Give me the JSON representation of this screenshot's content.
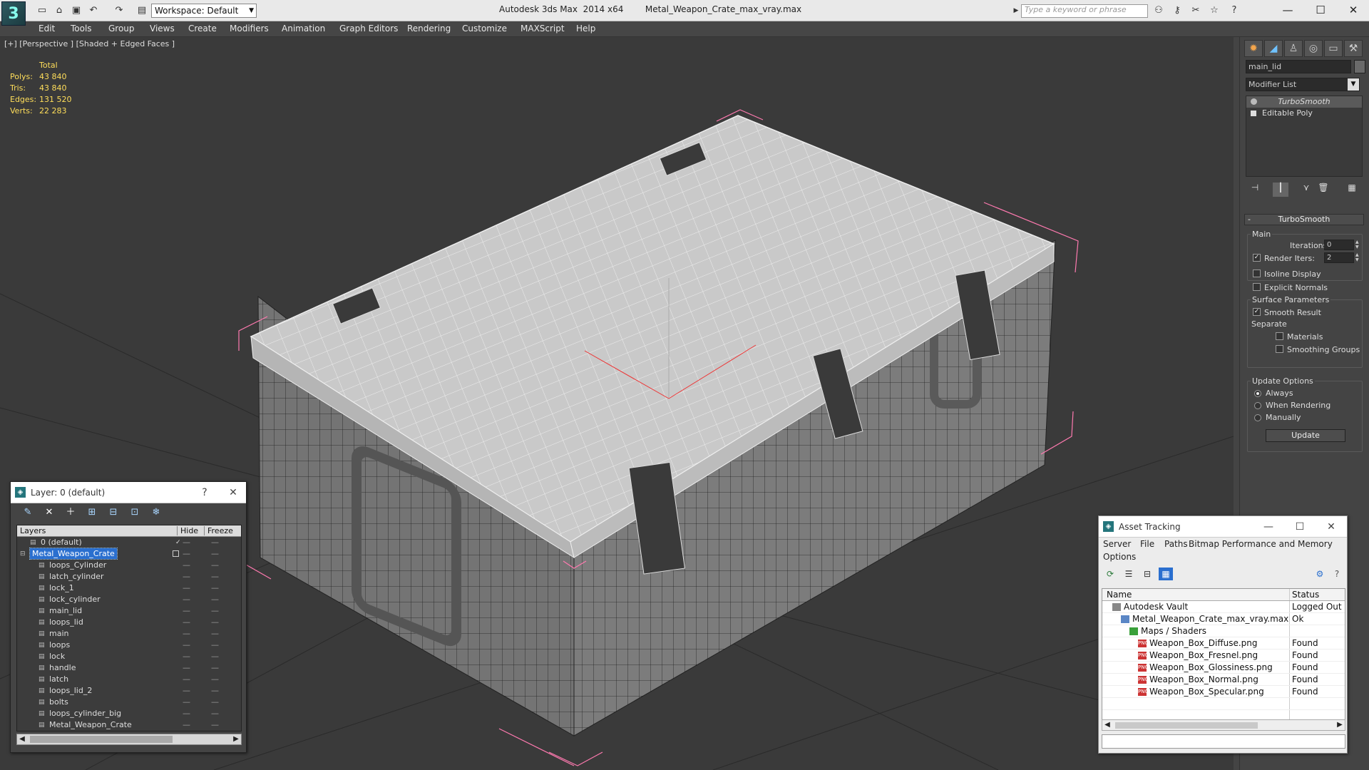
{
  "titlebar": {
    "app_title": "Autodesk 3ds Max  2014 x64",
    "file_title": "Metal_Weapon_Crate_max_vray.max",
    "workspace": "Workspace: Default",
    "search_placeholder": "Type a keyword or phrase",
    "logo": "3"
  },
  "menu": [
    "Edit",
    "Tools",
    "Group",
    "Views",
    "Create",
    "Modifiers",
    "Animation",
    "Graph Editors",
    "Rendering",
    "Customize",
    "MAXScript",
    "Help"
  ],
  "viewport": {
    "label": "[+] [Perspective ] [Shaded + Edged Faces ]",
    "stats": {
      "header": "Total",
      "rows": [
        {
          "label": "Polys:",
          "value": "43 840"
        },
        {
          "label": "Tris:",
          "value": "43 840"
        },
        {
          "label": "Edges:",
          "value": "131 520"
        },
        {
          "label": "Verts:",
          "value": "22 283"
        }
      ]
    }
  },
  "command_panel": {
    "object_name": "main_lid",
    "modifier_list": "Modifier List",
    "stack": [
      "TurboSmooth",
      "Editable Poly"
    ],
    "rollout_title": "TurboSmooth",
    "main_group": "Main",
    "iterations_label": "Iterations:",
    "iterations_value": "0",
    "render_iters_label": "Render Iters:",
    "render_iters_value": "2",
    "isoline_label": "Isoline Display",
    "explicit_normals_label": "Explicit Normals",
    "surface_group": "Surface Parameters",
    "smooth_result_label": "Smooth Result",
    "separate_label": "Separate",
    "materials_label": "Materials",
    "smoothing_groups_label": "Smoothing Groups",
    "update_group": "Update Options",
    "always_label": "Always",
    "when_rendering_label": "When Rendering",
    "manually_label": "Manually",
    "update_button": "Update"
  },
  "layer_panel": {
    "title": "Layer: 0 (default)",
    "help": "?",
    "columns": [
      "Layers",
      "Hide",
      "Freeze"
    ],
    "default_layer": "0 (default)",
    "selected_layer": "Metal_Weapon_Crate",
    "children": [
      "loops_Cylinder",
      "latch_cylinder",
      "lock_1",
      "lock_cylinder",
      "main_lid",
      "loops_lid",
      "main",
      "loops",
      "lock",
      "handle",
      "latch",
      "loops_lid_2",
      "bolts",
      "loops_cylinder_big",
      "Metal_Weapon_Crate"
    ]
  },
  "asset_panel": {
    "title": "Asset Tracking",
    "menu": [
      "Server",
      "File",
      "Paths",
      "Bitmap Performance and Memory",
      "Options"
    ],
    "columns": [
      "Name",
      "Status"
    ],
    "rows": [
      {
        "name": "Autodesk Vault",
        "status": "Logged Out ..."
      },
      {
        "name": "Metal_Weapon_Crate_max_vray.max",
        "status": "Ok"
      },
      {
        "name": "Maps / Shaders",
        "status": ""
      },
      {
        "name": "Weapon_Box_Diffuse.png",
        "status": "Found"
      },
      {
        "name": "Weapon_Box_Fresnel.png",
        "status": "Found"
      },
      {
        "name": "Weapon_Box_Glossiness.png",
        "status": "Found"
      },
      {
        "name": "Weapon_Box_Normal.png",
        "status": "Found"
      },
      {
        "name": "Weapon_Box_Specular.png",
        "status": "Found"
      }
    ]
  },
  "colors": {
    "viewport_bg": "#3a3a3a",
    "stats_text": "#ffde5a",
    "selection_blue": "#2a6fcf",
    "bbox_pink": "#ff7ab0",
    "wire_white": "#f0f0f0"
  }
}
